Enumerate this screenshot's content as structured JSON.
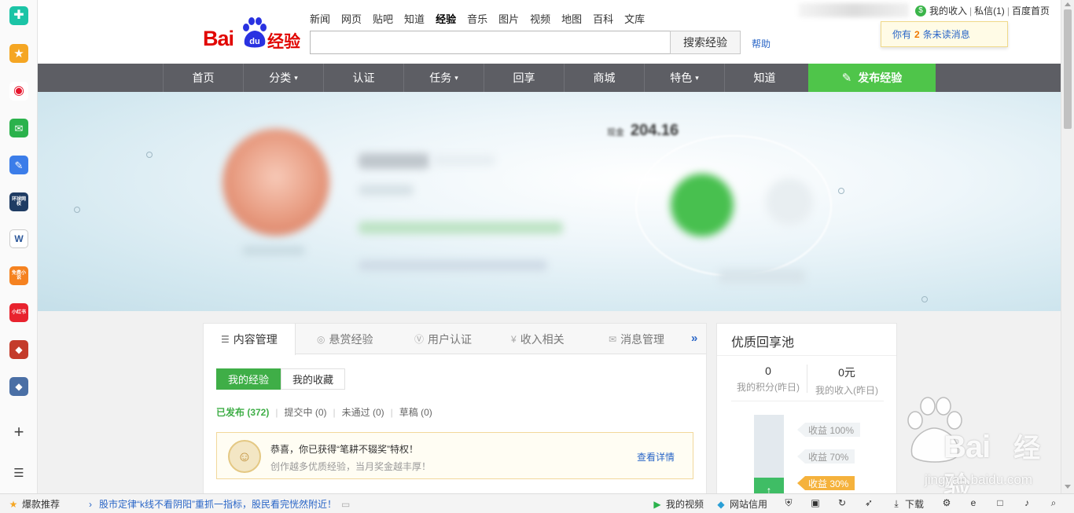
{
  "browser_sidebar": {
    "apps": [
      {
        "name": "health-app-icon",
        "color": "#1bc4a6",
        "glyph": "✚"
      },
      {
        "name": "favorites-icon",
        "color": "#f5a623",
        "glyph": "★"
      },
      {
        "name": "weibo-icon",
        "color": "#ffffff",
        "glyph": "◉"
      },
      {
        "name": "mail-icon",
        "color": "#2bb24c",
        "glyph": "✉"
      },
      {
        "name": "notes-icon",
        "color": "#3b7de9",
        "glyph": "✎"
      },
      {
        "name": "huanqiu-app-icon",
        "color": "#1f3c63",
        "glyph": "环球网校"
      },
      {
        "name": "word-doc-icon",
        "color": "#ffffff",
        "glyph": "W"
      },
      {
        "name": "free-novel-icon",
        "color": "#f58220",
        "glyph": "免费小说"
      },
      {
        "name": "xiaohongshu-icon",
        "color": "#e8232e",
        "glyph": "小红书"
      },
      {
        "name": "game-app-icon",
        "color": "#c43c2b",
        "glyph": "◆"
      },
      {
        "name": "game-app-2-icon",
        "color": "#4a6fa5",
        "glyph": "◆"
      }
    ],
    "tools": [
      {
        "name": "add-icon",
        "glyph": "+"
      },
      {
        "name": "menu-list-icon",
        "glyph": "☰"
      }
    ]
  },
  "header": {
    "logo_text": "Bai",
    "logo_du": "du",
    "logo_suffix": "经验",
    "top_nav": [
      "新闻",
      "网页",
      "贴吧",
      "知道",
      "经验",
      "音乐",
      "图片",
      "视频",
      "地图",
      "百科",
      "文库"
    ],
    "active_top_nav": "经验",
    "search_value": "",
    "search_button": "搜索经验",
    "help_link": "帮助",
    "user_links": {
      "income": "我的收入",
      "messages": "私信(1)",
      "home": "百度首页"
    },
    "notification": {
      "prefix": "你有",
      "count": "2",
      "suffix": "条未读消息"
    }
  },
  "main_nav": {
    "items": [
      {
        "label": "首页",
        "dropdown": false
      },
      {
        "label": "分类",
        "dropdown": true
      },
      {
        "label": "认证",
        "dropdown": false
      },
      {
        "label": "任务",
        "dropdown": true
      },
      {
        "label": "回享",
        "dropdown": false
      },
      {
        "label": "商城",
        "dropdown": false
      },
      {
        "label": "特色",
        "dropdown": true
      },
      {
        "label": "知道",
        "dropdown": false
      }
    ],
    "publish_button": "发布经验"
  },
  "banner": {
    "score_label": "现金",
    "score_value": "204.16"
  },
  "content_panel": {
    "tabs": [
      {
        "label": "内容管理",
        "icon": "list-icon",
        "glyph": "☰",
        "active": true
      },
      {
        "label": "悬赏经验",
        "icon": "reward-icon",
        "glyph": "◎",
        "active": false
      },
      {
        "label": "用户认证",
        "icon": "verify-icon",
        "glyph": "Ⓥ",
        "active": false
      },
      {
        "label": "收入相关",
        "icon": "yen-icon",
        "glyph": "¥",
        "active": false
      },
      {
        "label": "消息管理",
        "icon": "message-icon",
        "glyph": "✉",
        "active": false
      }
    ],
    "more": "»",
    "subtabs": [
      "我的经验",
      "我的收藏"
    ],
    "filters": [
      {
        "label": "已发布 (372)",
        "active": true
      },
      {
        "label": "提交中 (0)",
        "active": false
      },
      {
        "label": "未通过 (0)",
        "active": false
      },
      {
        "label": "草稿 (0)",
        "active": false
      }
    ],
    "award": {
      "title": "恭喜，你已获得“笔耕不辍奖”特权！",
      "subtitle": "创作越多优质经验，当月奖金越丰厚！",
      "link": "查看详情"
    }
  },
  "pool_panel": {
    "title": "优质回享池",
    "points_value": "0",
    "points_label": "我的积分(昨日)",
    "income_value": "0元",
    "income_label": "我的收入(昨日)",
    "levels": [
      {
        "label": "收益 100%",
        "active": false
      },
      {
        "label": "收益 70%",
        "active": false
      },
      {
        "label": "收益 30%",
        "active": true
      }
    ],
    "current_level_fraction": 0.3
  },
  "watermark": {
    "brand": "Bai",
    "suffix": "经验",
    "url": "jingyan.baidu.com"
  },
  "status_bar": {
    "left": [
      {
        "icon": "hot-recommend-icon",
        "glyph": "★",
        "label": "爆款推荐"
      },
      {
        "icon": "news-arrow-icon",
        "glyph": "›",
        "label": "股市定律“k线不看阴阳”重抓一指标，股民看完恍然附近！"
      }
    ],
    "right": [
      {
        "icon": "video-icon",
        "glyph": "▶",
        "label": "我的视频"
      },
      {
        "icon": "credit-icon",
        "glyph": "◆",
        "label": "网站信用"
      },
      {
        "icon": "shield-icon",
        "glyph": "⛨",
        "label": ""
      },
      {
        "icon": "image-icon",
        "glyph": "▣",
        "label": ""
      },
      {
        "icon": "refresh-icon",
        "glyph": "↻",
        "label": ""
      },
      {
        "icon": "rocket-icon",
        "glyph": "➶",
        "label": ""
      },
      {
        "icon": "download-icon",
        "glyph": "⤓",
        "label": "下载"
      },
      {
        "icon": "extension-icon",
        "glyph": "⚙",
        "label": ""
      },
      {
        "icon": "ie-icon",
        "glyph": "e",
        "label": ""
      },
      {
        "icon": "window-icon",
        "glyph": "□",
        "label": ""
      },
      {
        "icon": "volume-icon",
        "glyph": "♪",
        "label": ""
      },
      {
        "icon": "zoom-icon",
        "glyph": "⌕",
        "label": ""
      }
    ]
  }
}
